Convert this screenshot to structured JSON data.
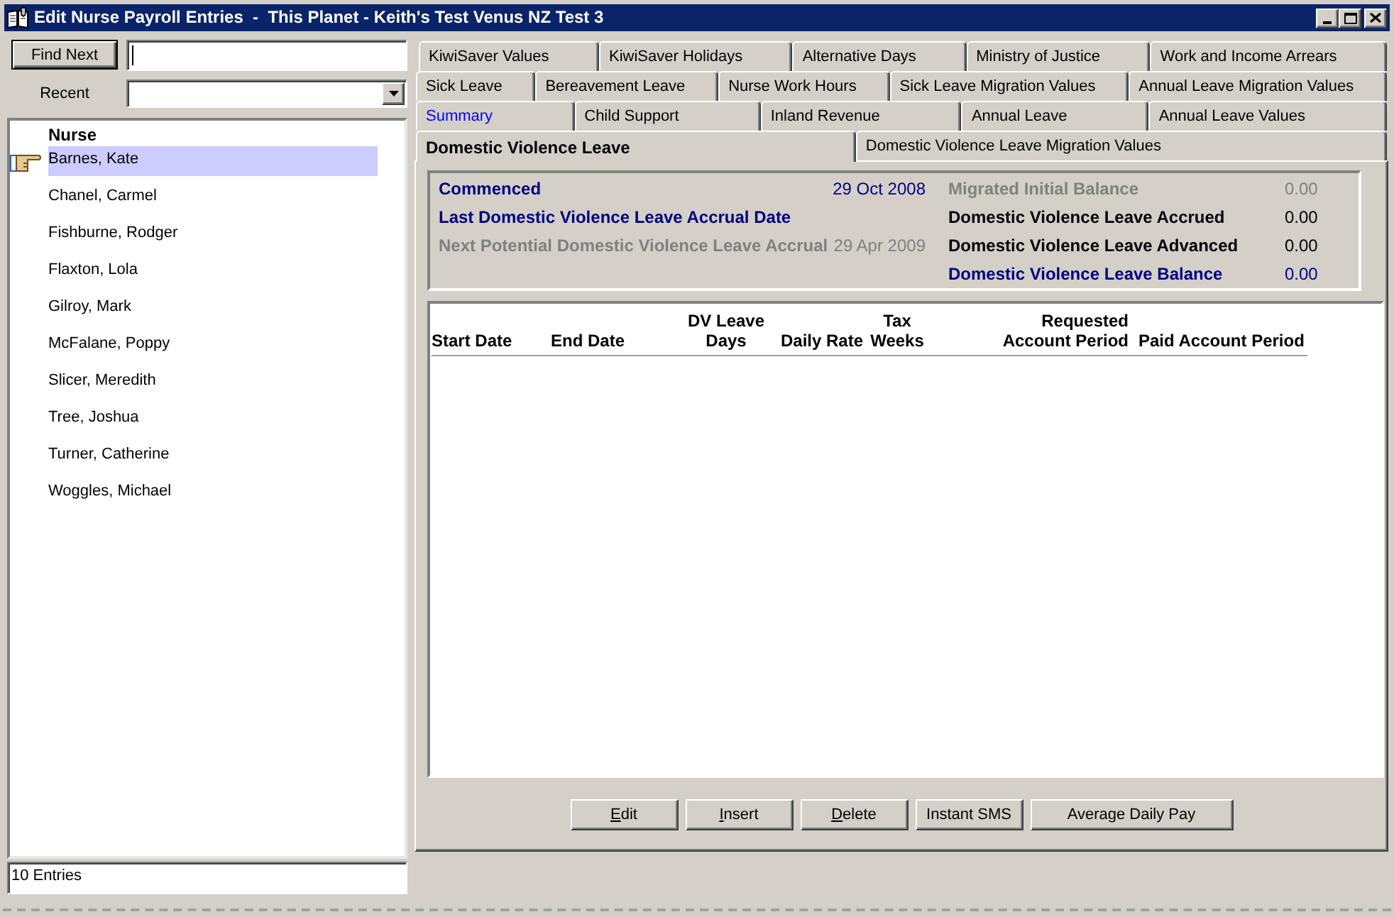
{
  "window": {
    "title": "Edit Nurse Payroll Entries  -  This Planet - Keith's Test Venus NZ Test 3"
  },
  "search": {
    "button": "Find Next"
  },
  "recent": {
    "label": "Recent"
  },
  "nurse_list": {
    "heading": "Nurse",
    "items": [
      {
        "name": "Barnes, Kate",
        "selected": true
      },
      {
        "name": "Chanel, Carmel",
        "selected": false
      },
      {
        "name": "Fishburne, Rodger",
        "selected": false
      },
      {
        "name": "Flaxton, Lola",
        "selected": false
      },
      {
        "name": "Gilroy, Mark",
        "selected": false
      },
      {
        "name": "McFalane, Poppy",
        "selected": false
      },
      {
        "name": "Slicer, Meredith",
        "selected": false
      },
      {
        "name": "Tree, Joshua",
        "selected": false
      },
      {
        "name": "Turner, Catherine",
        "selected": false
      },
      {
        "name": "Woggles, Michael",
        "selected": false
      }
    ]
  },
  "entry_count": "10 Entries",
  "tab_rows": [
    [
      {
        "label": "KiwiSaver Values",
        "selected": false,
        "highlighted": false
      },
      {
        "label": "KiwiSaver Holidays",
        "selected": false,
        "highlighted": false
      },
      {
        "label": "Alternative Days",
        "selected": false,
        "highlighted": false
      },
      {
        "label": "Ministry of Justice",
        "selected": false,
        "highlighted": false
      },
      {
        "label": "Work and Income Arrears",
        "selected": false,
        "highlighted": false
      }
    ],
    [
      {
        "label": "Sick Leave",
        "selected": false,
        "highlighted": false
      },
      {
        "label": "Bereavement Leave",
        "selected": false,
        "highlighted": false
      },
      {
        "label": "Nurse Work Hours",
        "selected": false,
        "highlighted": false
      },
      {
        "label": "Sick Leave Migration Values",
        "selected": false,
        "highlighted": false
      },
      {
        "label": "Annual Leave Migration Values",
        "selected": false,
        "highlighted": false
      }
    ],
    [
      {
        "label": "Summary",
        "selected": false,
        "highlighted": true
      },
      {
        "label": "Child Support",
        "selected": false,
        "highlighted": false
      },
      {
        "label": "Inland Revenue",
        "selected": false,
        "highlighted": false
      },
      {
        "label": "Annual Leave",
        "selected": false,
        "highlighted": false
      },
      {
        "label": "Annual Leave Values",
        "selected": false,
        "highlighted": false
      }
    ],
    [
      {
        "label": "Domestic Violence Leave",
        "selected": true,
        "highlighted": false
      },
      {
        "label": "Domestic Violence Leave Migration Values",
        "selected": false,
        "highlighted": false
      }
    ]
  ],
  "summary": {
    "left": [
      {
        "label": "Commenced",
        "value": "29 Oct 2008",
        "highlighted": true,
        "disabled": false
      },
      {
        "label": "Last Domestic Violence Leave Accrual Date",
        "highlighted": true,
        "disabled": false
      },
      {
        "label": "Next Potential Domestic Violence Leave Accrual",
        "value": "29 Apr 2009",
        "highlighted": false,
        "disabled": true
      }
    ],
    "right": [
      {
        "label": "Migrated Initial Balance",
        "value": "0.00",
        "highlighted": false,
        "disabled": true
      },
      {
        "label": "Domestic Violence Leave Accrued",
        "value": "0.00",
        "highlighted": false,
        "disabled": false
      },
      {
        "label": "Domestic Violence Leave Advanced",
        "value": "0.00",
        "highlighted": false,
        "disabled": false
      },
      {
        "label": "Domestic Violence Leave Balance",
        "value": "0.00",
        "highlighted": true,
        "disabled": false
      }
    ]
  },
  "table": {
    "columns": [
      "Start Date",
      "End Date",
      "DV Leave\nDays",
      "Daily Rate",
      "Tax\nWeeks",
      "Requested\nAccount Period",
      "Paid Account Period"
    ]
  },
  "buttons": [
    {
      "label": "Edit",
      "mnemonic": true
    },
    {
      "label": "Insert",
      "mnemonic": true
    },
    {
      "label": "Delete",
      "mnemonic": true
    },
    {
      "label": "Instant SMS",
      "mnemonic": false
    },
    {
      "label": "Average Daily Pay",
      "mnemonic": false
    }
  ]
}
